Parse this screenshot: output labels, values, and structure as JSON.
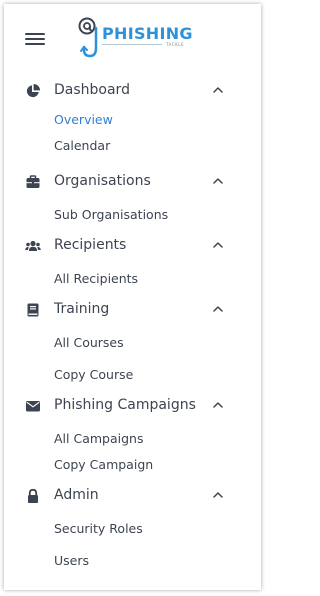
{
  "brand": {
    "name": "PHISHING",
    "tagline": "TACKLE",
    "accent": "#2f92d8"
  },
  "menu": {
    "toggle_icon": "hamburger-icon",
    "active_color": "#2f7fd6",
    "text_color": "#3d4451"
  },
  "sections": [
    {
      "title": "Dashboard",
      "icon": "pie-chart-icon",
      "expanded": true,
      "items": [
        {
          "label": "Overview",
          "active": true
        },
        {
          "label": "Calendar"
        }
      ]
    },
    {
      "title": "Organisations",
      "icon": "briefcase-icon",
      "expanded": true,
      "items": [
        {
          "label": "Sub Organisations"
        }
      ]
    },
    {
      "title": "Recipients",
      "icon": "users-icon",
      "expanded": true,
      "items": [
        {
          "label": "All Recipients"
        }
      ]
    },
    {
      "title": "Training",
      "icon": "book-icon",
      "expanded": true,
      "items": [
        {
          "label": "All Courses"
        },
        {
          "label": "Copy Course"
        }
      ]
    },
    {
      "title": "Phishing Campaigns",
      "icon": "envelope-icon",
      "expanded": true,
      "items": [
        {
          "label": "All Campaigns"
        },
        {
          "label": "Copy Campaign"
        }
      ]
    },
    {
      "title": "Admin",
      "icon": "lock-icon",
      "expanded": true,
      "items": [
        {
          "label": "Security Roles"
        },
        {
          "label": "Users"
        }
      ]
    }
  ]
}
